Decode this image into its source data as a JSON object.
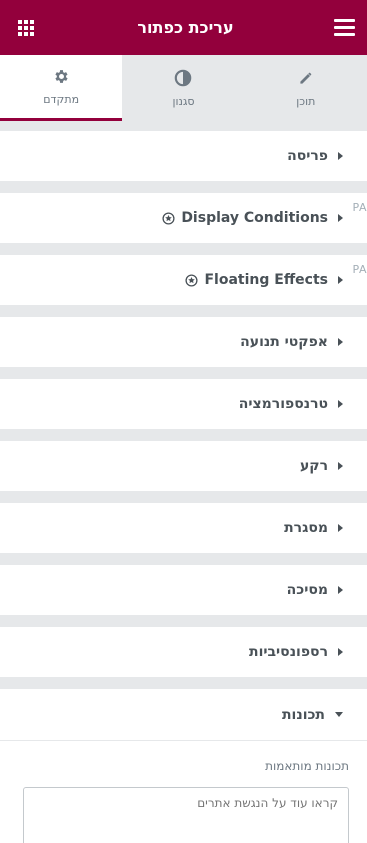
{
  "header": {
    "title": "עריכת כפתור",
    "grid_icon": "apps-grid-icon",
    "menu_icon": "hamburger-menu-icon",
    "background": "#93003c"
  },
  "tabs": [
    {
      "label": "תוכן",
      "icon": "pencil-icon"
    },
    {
      "label": "סגנון",
      "icon": "half-circle-contrast-icon"
    },
    {
      "label": "מתקדם",
      "icon": "gear-icon"
    }
  ],
  "sections": [
    {
      "title": "פריסה"
    },
    {
      "title": "Display Conditions",
      "badge": "PA"
    },
    {
      "title": "Floating Effects",
      "badge": "PA"
    },
    {
      "title": "אפקטי תנועה"
    },
    {
      "title": "טרנספורמציה"
    },
    {
      "title": "רקע"
    },
    {
      "title": "מסגרת"
    },
    {
      "title": "מסיכה"
    },
    {
      "title": "רספונסיביות"
    }
  ],
  "expanded_section": {
    "title": "תכונות",
    "control_label": "תכונות מותאמות",
    "textarea_placeholder": "קראו עוד על הנגשת אתרים"
  }
}
